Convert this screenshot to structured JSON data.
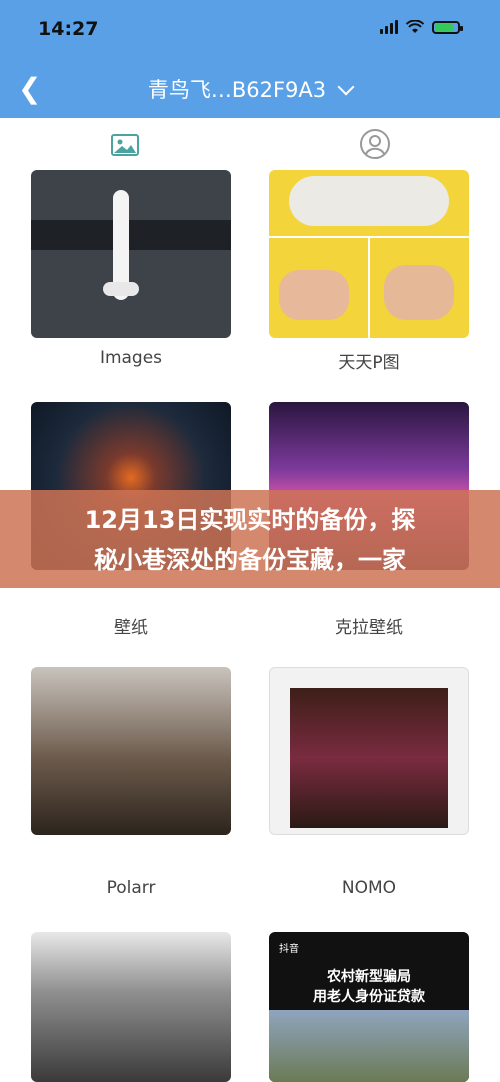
{
  "status_bar": {
    "time": "14:27"
  },
  "header": {
    "title": "青鸟飞…B62F9A3"
  },
  "albums": [
    {
      "label": "Images"
    },
    {
      "label": "天天P图"
    },
    {
      "label": "壁纸"
    },
    {
      "label": "克拉壁纸"
    },
    {
      "label": "Polarr"
    },
    {
      "label": "NOMO"
    },
    {
      "label": ""
    },
    {
      "label": ""
    }
  ],
  "thumb_text": {
    "tiktok": "抖音",
    "line1": "农村新型骗局",
    "line2": "用老人身份证贷款"
  },
  "banner": {
    "line1": "12月13日实现实时的备份，探",
    "line2": "秘小巷深处的备份宝藏，一家"
  },
  "colors": {
    "header_bg": "#5aa0e6",
    "banner_bg": "#cd7355"
  }
}
